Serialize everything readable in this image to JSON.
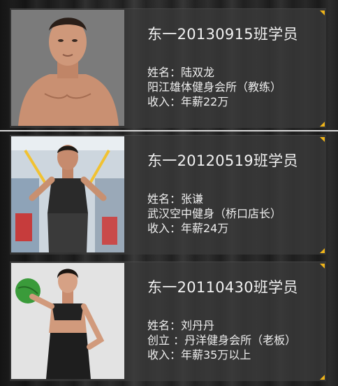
{
  "cards": [
    {
      "title": "东一20130915班学员",
      "lines": [
        "姓名：陆双龙",
        "阳江雄体健身会所（教练）",
        "收入：年薪22万"
      ]
    },
    {
      "title": "东一20120519班学员",
      "lines": [
        "姓名：张谦",
        "武汉空中健身（桥口店长）",
        "收入：年薪24万"
      ]
    },
    {
      "title": "东一20110430班学员",
      "lines": [
        "姓名：刘丹丹",
        "创立 ：丹洋健身会所（老板）",
        "收入：年薪35万以上"
      ]
    }
  ],
  "colors": {
    "accent": "#f0b51a",
    "text": "#eeeeee"
  }
}
